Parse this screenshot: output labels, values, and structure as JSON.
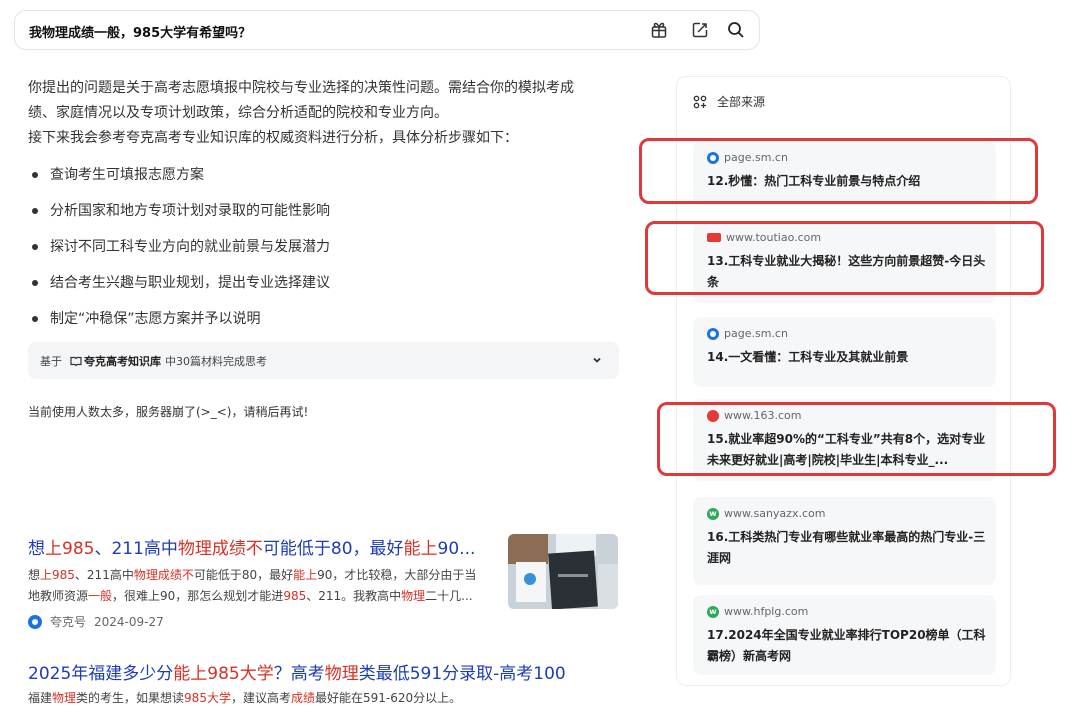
{
  "search": {
    "query": "我物理成绩一般，985大学有希望吗？"
  },
  "icons": {
    "gift": "gift-icon",
    "share": "share-edit-icon",
    "search": "search-icon"
  },
  "answer": {
    "lines": [
      "你提出的问题是关于高考志愿填报中院校与专业选择的决策性问题。需结合你的模拟考成",
      "绩、家庭情况以及专项计划政策，综合分析适配的院校和专业方向。",
      "接下来我会参考夸克高考专业知识库的权威资料进行分析，具体分析步骤如下："
    ],
    "steps": [
      "查询考生可填报志愿方案",
      "分析国家和地方专项计划对录取的可能性影响",
      "探讨不同工科专业方向的就业前景与发展潜力",
      "结合考生兴趣与职业规划，提出专业选择建议",
      "制定“冲稳保”志愿方案并予以说明"
    ]
  },
  "knowledge": {
    "prefix": "基于",
    "name": "夸克高考知识库",
    "suffix": "中30篇材料完成思考"
  },
  "server_message": "当前使用人数太多，服务器崩了(>_<)，请稍后再试!",
  "results": [
    {
      "title_parts": [
        {
          "t": "想",
          "hl": false
        },
        {
          "t": "上985",
          "hl": true
        },
        {
          "t": "、211高中",
          "hl": false
        },
        {
          "t": "物理成绩不",
          "hl": true
        },
        {
          "t": "可能低于80，最好",
          "hl": false
        },
        {
          "t": "能上",
          "hl": true
        },
        {
          "t": "90...",
          "hl": false
        }
      ],
      "snippet_line1": [
        {
          "t": "想",
          "hl": false
        },
        {
          "t": "上985",
          "hl": true
        },
        {
          "t": "、211高中",
          "hl": false
        },
        {
          "t": "物理成绩不",
          "hl": true
        },
        {
          "t": "可能低于80，最好",
          "hl": false
        },
        {
          "t": "能上",
          "hl": true
        },
        {
          "t": "90，才比较稳，大部分由于当",
          "hl": false
        }
      ],
      "snippet_line2": [
        {
          "t": "地教师资源",
          "hl": false
        },
        {
          "t": "一般",
          "hl": true
        },
        {
          "t": "，很难上90，那怎么规划才能进",
          "hl": false
        },
        {
          "t": "985",
          "hl": true
        },
        {
          "t": "、211。我教高中",
          "hl": false
        },
        {
          "t": "物理",
          "hl": true
        },
        {
          "t": "二十几...",
          "hl": false
        }
      ],
      "source": "夸克号",
      "date": "2024-09-27"
    },
    {
      "title_parts": [
        {
          "t": "2025年福建多少分",
          "hl": false
        },
        {
          "t": "能上985大学",
          "hl": true
        },
        {
          "t": "？高考",
          "hl": false
        },
        {
          "t": "物理",
          "hl": true
        },
        {
          "t": "类最低591分录取-高考100",
          "hl": false
        }
      ],
      "snippet_line1": [
        {
          "t": "福建",
          "hl": false
        },
        {
          "t": "物理",
          "hl": true
        },
        {
          "t": "类的考生，如果想读",
          "hl": false
        },
        {
          "t": "985大学",
          "hl": true
        },
        {
          "t": "，建议高考",
          "hl": false
        },
        {
          "t": "成绩",
          "hl": true
        },
        {
          "t": "最好能在591-620分以上。",
          "hl": false
        }
      ]
    }
  ],
  "sources": {
    "header": "全部来源",
    "items": [
      {
        "domain": "page.sm.cn",
        "favicon": "sm-icon",
        "title": "12.秒懂：热门工科专业前景与特点介绍"
      },
      {
        "domain": "www.toutiao.com",
        "favicon": "toutiao-icon",
        "title": "13.工科专业就业大揭秘！这些方向前景超赞-今日头条"
      },
      {
        "domain": "page.sm.cn",
        "favicon": "sm-icon",
        "title": "14.一文看懂：工科专业及其就业前景"
      },
      {
        "domain": "www.163.com",
        "favicon": "netease-icon",
        "title": "15.就业率超90%的“工科专业”共有8个，选对专业未来更好就业|高考|院校|毕业生|本科专业_..."
      },
      {
        "domain": "www.sanyazx.com",
        "favicon": "w-icon",
        "title": "16.工科类热门专业有哪些就业率最高的热门专业-三涯网"
      },
      {
        "domain": "www.hfplg.com",
        "favicon": "w-icon",
        "title": "17.2024年全国专业就业率排行TOP20榜单（工科霸榜）新高考网"
      }
    ]
  },
  "colors": {
    "highlight": "#d93025",
    "link": "#1d3db5",
    "annotation": "#e0383b"
  }
}
